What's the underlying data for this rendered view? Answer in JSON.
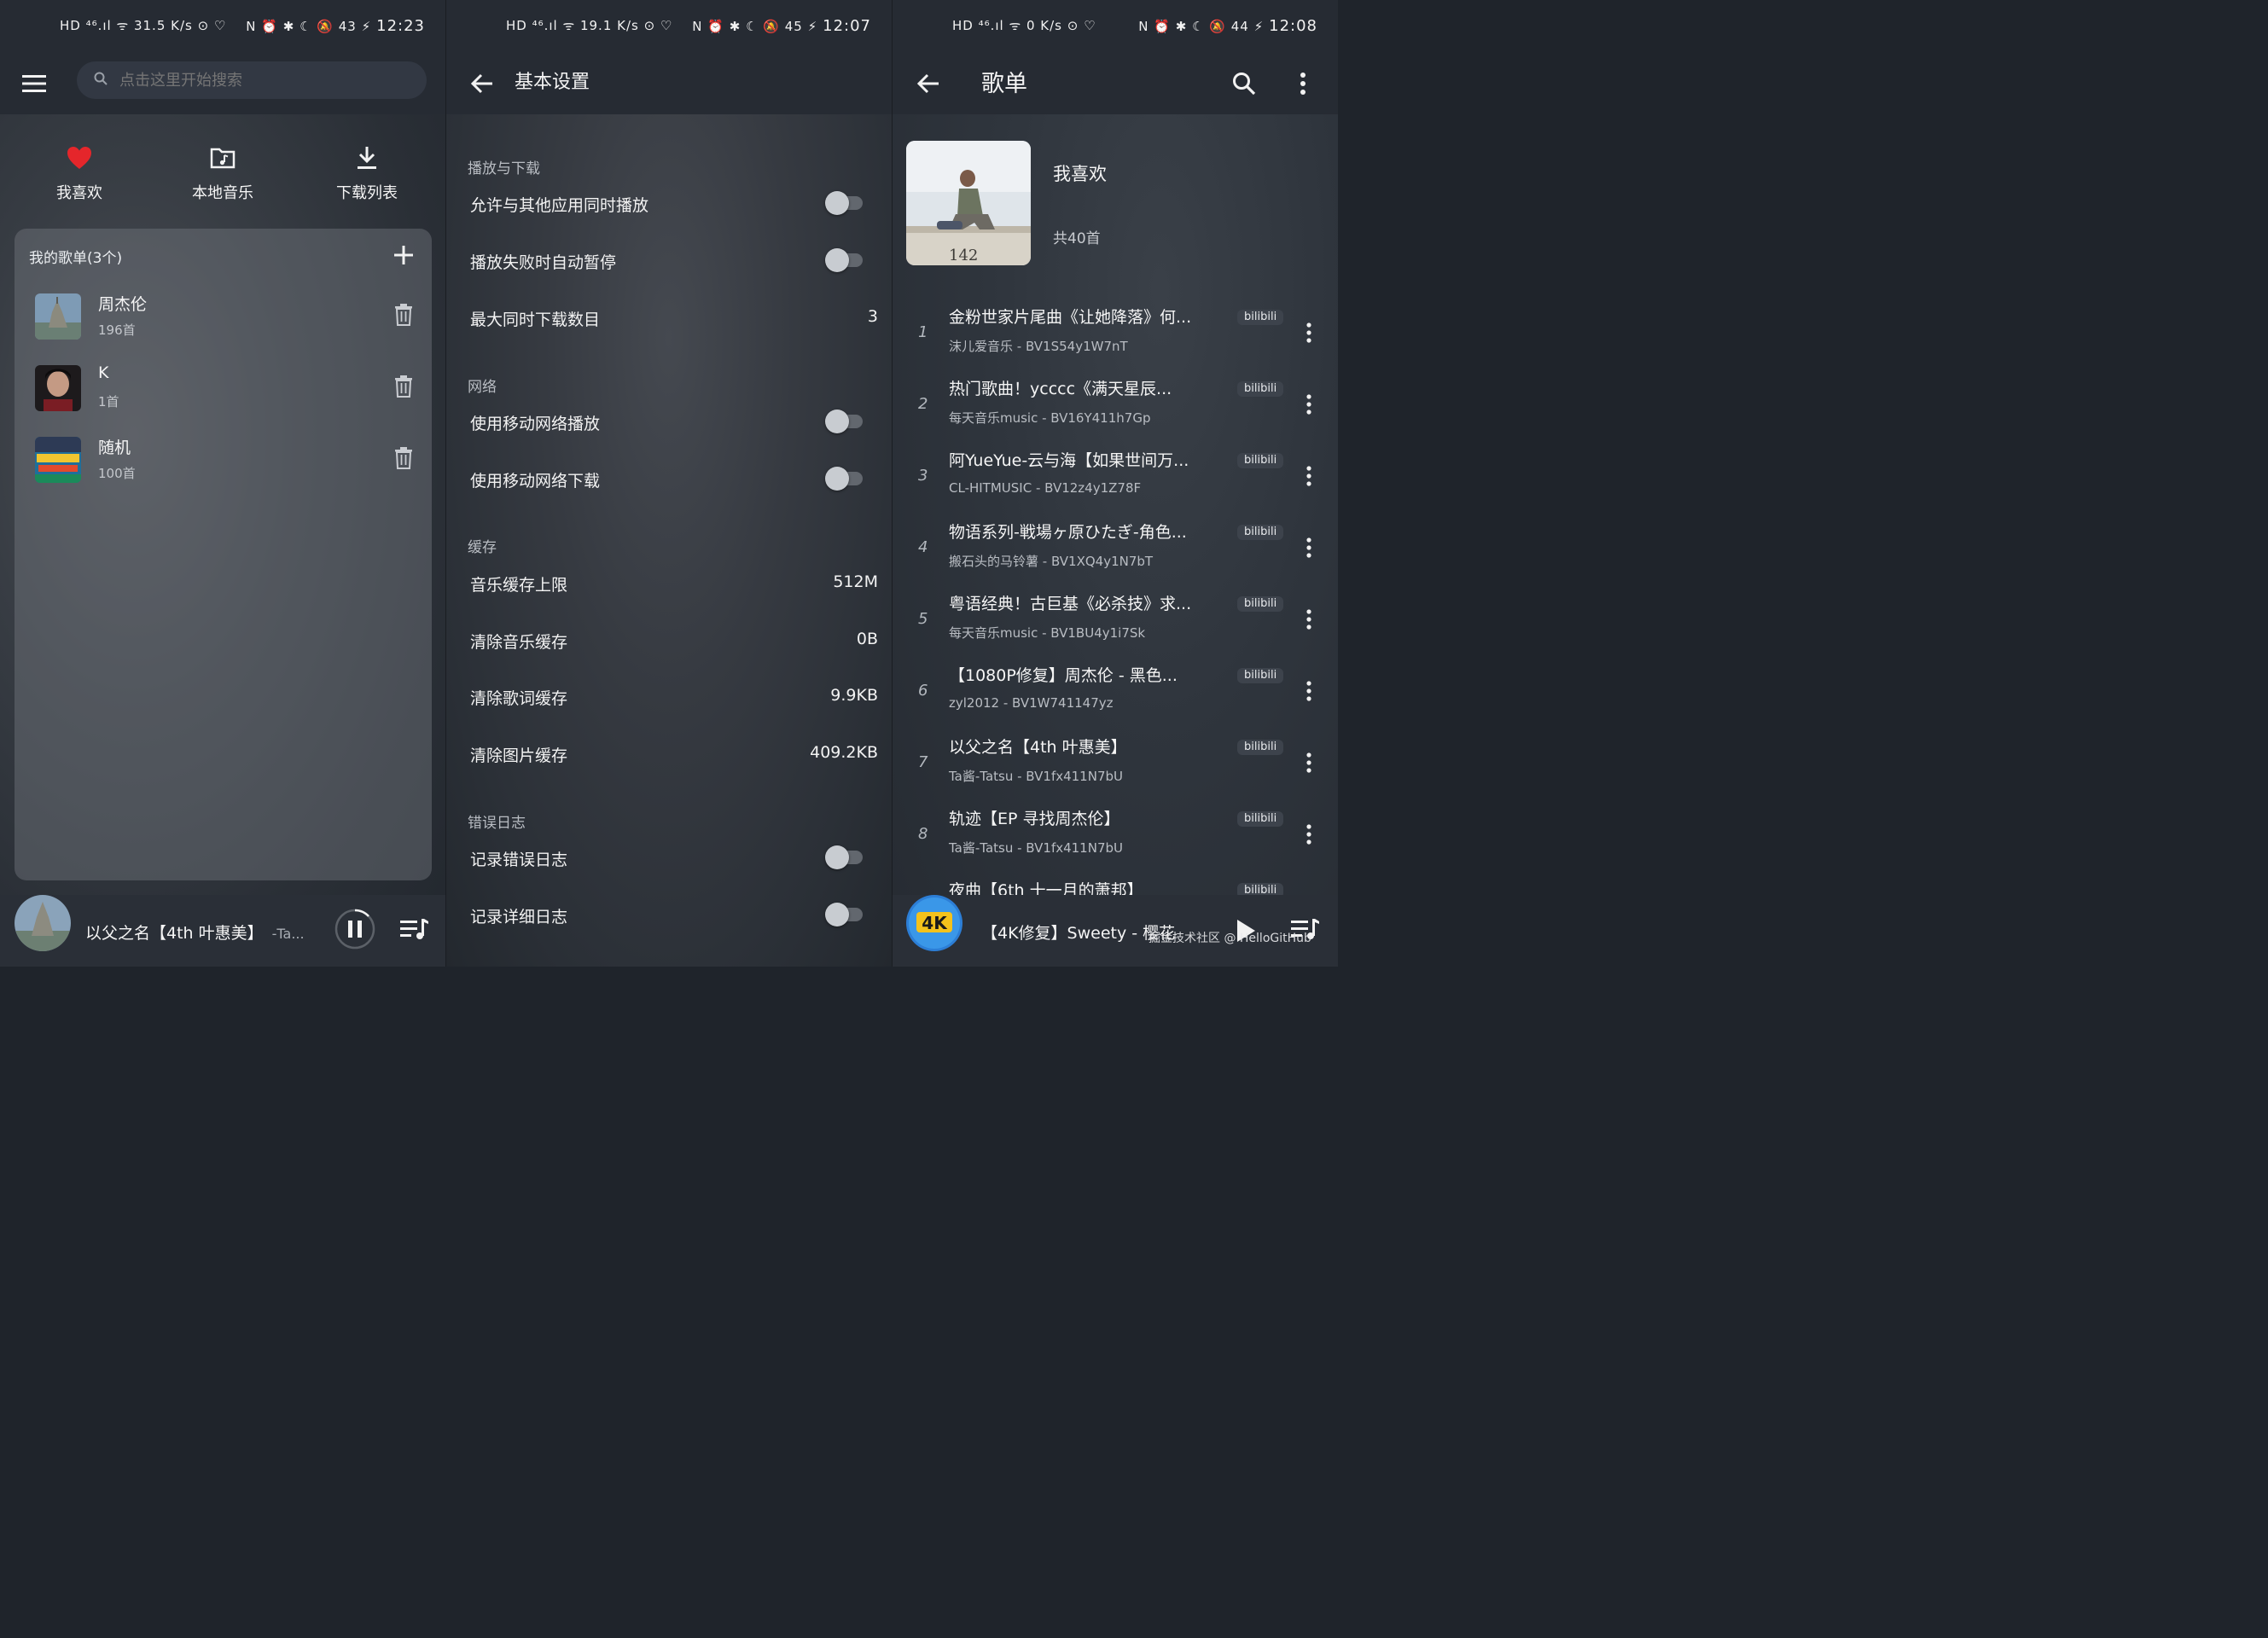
{
  "panel1": {
    "status": {
      "left": "HD ⁴⁶.ıl ᯤ 31.5 K/s ⊙ ♡",
      "right": "N ⏰ ✱ ☾ 🔕 43 ⚡",
      "time": "12:23"
    },
    "search_placeholder": "点击这里开始搜索",
    "shortcuts": [
      {
        "label": "我喜欢",
        "icon": "heart-icon"
      },
      {
        "label": "本地音乐",
        "icon": "folder-music-icon"
      },
      {
        "label": "下载列表",
        "icon": "download-icon"
      }
    ],
    "my_playlists_header": "我的歌单(3个)",
    "playlists": [
      {
        "name": "周杰伦",
        "count": "196首"
      },
      {
        "name": "K",
        "count": "1首"
      },
      {
        "name": "随机",
        "count": "100首"
      }
    ],
    "now_playing": {
      "title": "以父之名【4th 叶惠美】",
      "artist": "-Ta..."
    }
  },
  "panel2": {
    "status": {
      "left": "HD ⁴⁶.ıl ᯤ 19.1 K/s ⊙ ♡",
      "right": "N ⏰ ✱ ☾ 🔕 45 ⚡",
      "time": "12:07"
    },
    "title": "基本设置",
    "sections": {
      "playback": "播放与下载",
      "network": "网络",
      "cache": "缓存",
      "errorlog": "错误日志"
    },
    "rows": {
      "allow_other_apps": "允许与其他应用同时播放",
      "auto_pause": "播放失败时自动暂停",
      "max_downloads_label": "最大同时下载数目",
      "max_downloads_value": "3",
      "mobile_play": "使用移动网络播放",
      "mobile_download": "使用移动网络下载",
      "cache_limit_label": "音乐缓存上限",
      "cache_limit_value": "512M",
      "clear_music_label": "清除音乐缓存",
      "clear_music_value": "0B",
      "clear_lyrics_label": "清除歌词缓存",
      "clear_lyrics_value": "9.9KB",
      "clear_images_label": "清除图片缓存",
      "clear_images_value": "409.2KB",
      "log_errors": "记录错误日志",
      "log_verbose": "记录详细日志"
    },
    "toggles": {
      "allow_other_apps": false,
      "auto_pause": false,
      "mobile_play": false,
      "mobile_download": false,
      "log_errors": false,
      "log_verbose": false
    }
  },
  "panel3": {
    "status": {
      "left": "HD ⁴⁶.ıl ᯤ 0 K/s ⊙ ♡",
      "right": "N ⏰ ✱ ☾ 🔕 44 ⚡",
      "time": "12:08"
    },
    "title": "歌单",
    "playlist_title": "我喜欢",
    "playlist_total": "共40首",
    "cover_number": "142",
    "songs": [
      {
        "num": "1",
        "title": "金粉世家片尾曲《让她降落》何...",
        "sub": "沫儿爱音乐 - BV1S54y1W7nT",
        "badge": "bilibili"
      },
      {
        "num": "2",
        "title": "热门歌曲！ycccc《满天星辰...",
        "sub": "每天音乐music - BV16Y411h7Gp",
        "badge": "bilibili"
      },
      {
        "num": "3",
        "title": "阿YueYue-云与海【如果世间万...",
        "sub": "CL-HITMUSIC - BV12z4y1Z78F",
        "badge": "bilibili"
      },
      {
        "num": "4",
        "title": "物语系列-戦場ヶ原ひたぎ-角色...",
        "sub": "搬石头的马铃薯 - BV1XQ4y1N7bT",
        "badge": "bilibili"
      },
      {
        "num": "5",
        "title": "粤语经典！古巨基《必杀技》求...",
        "sub": "每天音乐music - BV1BU4y1i7Sk",
        "badge": "bilibili"
      },
      {
        "num": "6",
        "title": "【1080P修复】周杰伦 - 黑色...",
        "sub": "zyl2012 - BV1W741147yz",
        "badge": "bilibili"
      },
      {
        "num": "7",
        "title": "以父之名【4th 叶惠美】",
        "sub": "Ta酱-Tatsu - BV1fx411N7bU",
        "badge": "bilibili"
      },
      {
        "num": "8",
        "title": "轨迹【EP 寻找周杰伦】",
        "sub": "Ta酱-Tatsu - BV1fx411N7bU",
        "badge": "bilibili"
      },
      {
        "num": "9",
        "title": "夜曲【6th 十一月的萧邦】",
        "sub": "",
        "badge": "bilibili"
      }
    ],
    "now_playing": {
      "title": "【4K修复】Sweety - 樱花",
      "disc_text": "4K"
    },
    "watermark": "掘金技术社区 @ HelloGitHub"
  },
  "colors": {
    "heart": "#e5262b",
    "background": "#2b3037",
    "bar": "#262b33"
  }
}
